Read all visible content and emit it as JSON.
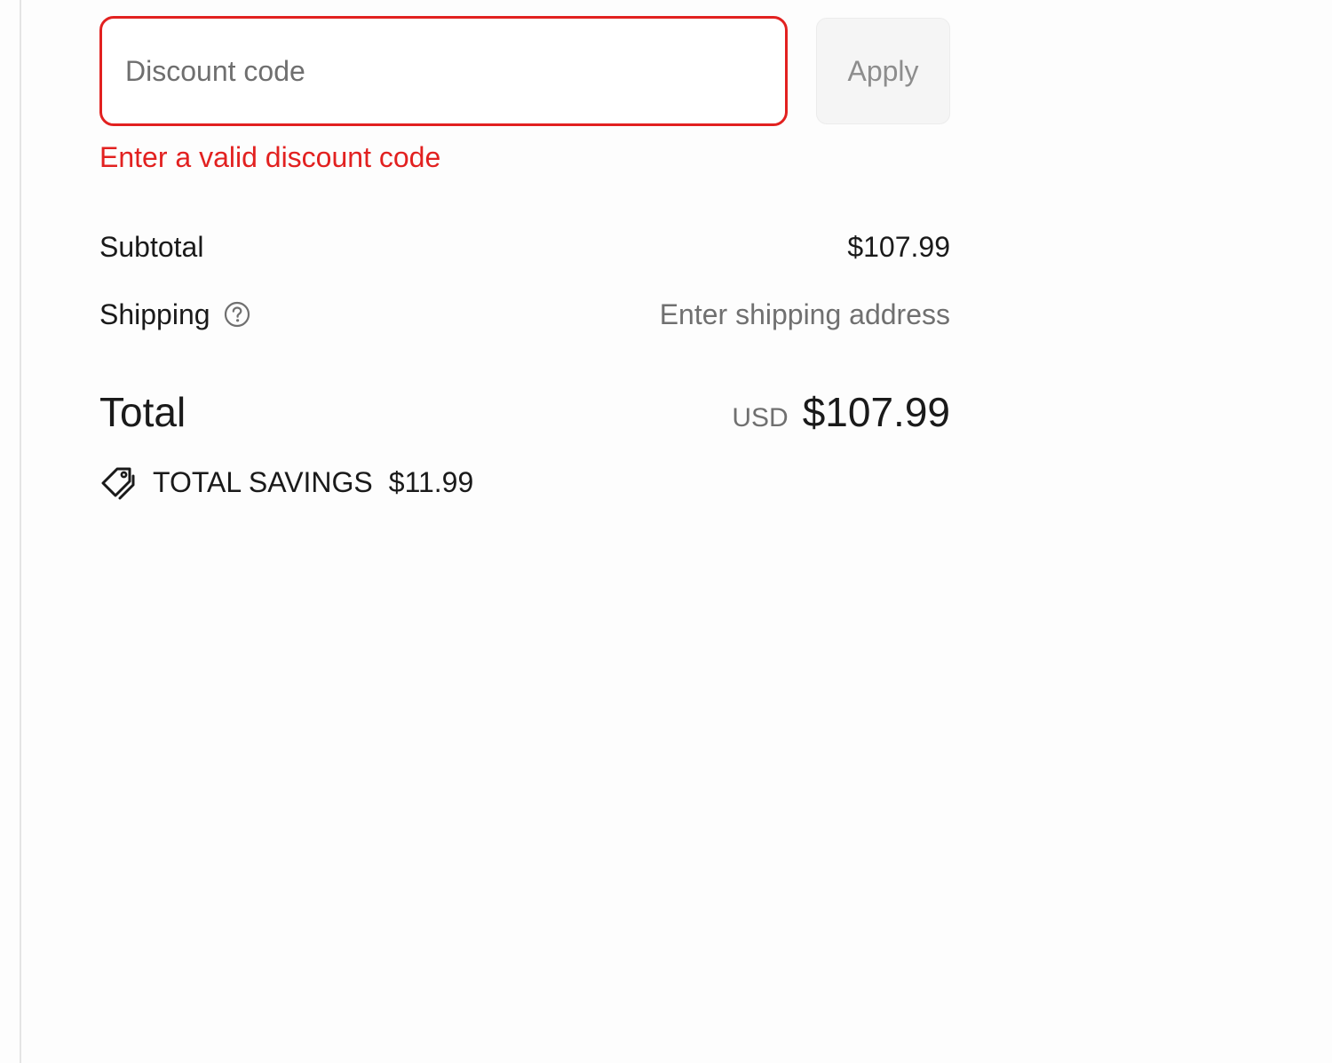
{
  "discount": {
    "placeholder": "Discount code",
    "value": "",
    "apply_label": "Apply",
    "error": "Enter a valid discount code",
    "error_color": "#e22120"
  },
  "summary": {
    "subtotal_label": "Subtotal",
    "subtotal_value": "$107.99",
    "shipping_label": "Shipping",
    "shipping_value": "Enter shipping address",
    "total_label": "Total",
    "currency": "USD",
    "total_value": "$107.99",
    "savings_label": "TOTAL SAVINGS",
    "savings_value": "$11.99"
  },
  "icons": {
    "shipping_help": "help-circle-icon",
    "savings": "price-tag-icon"
  }
}
